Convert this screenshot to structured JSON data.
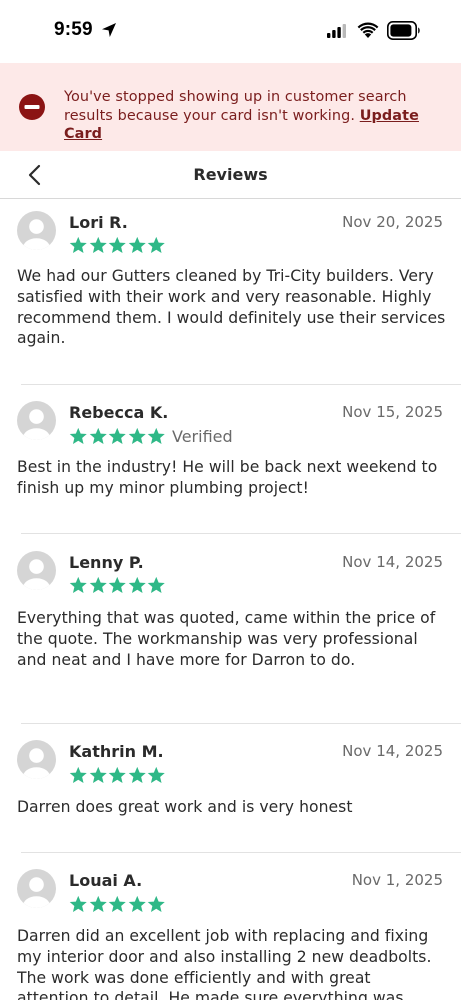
{
  "status_bar": {
    "time": "9:59",
    "location_icon": "location-arrow-icon",
    "signal_icon": "cellular-signal-icon",
    "wifi_icon": "wifi-icon",
    "battery_icon": "battery-icon"
  },
  "alert": {
    "icon": "minus-circle-icon",
    "message": "You've stopped showing up in customer search results because your card isn't working.",
    "link_label": "Update Card"
  },
  "header": {
    "back_icon": "chevron-left-icon",
    "title": "Reviews"
  },
  "colors": {
    "star": "#2fb887",
    "alert_bg": "#fde9e8",
    "alert_text": "#7a1d1d"
  },
  "reviews": [
    {
      "name": "Lori R.",
      "date": "Nov 20, 2025",
      "rating": 5,
      "verified": "",
      "text": "We had our Gutters cleaned by Tri-City builders. Very satisfied with their work and very reasonable. Highly recommend them. I would definitely use their services again."
    },
    {
      "name": "Rebecca K.",
      "date": "Nov 15, 2025",
      "rating": 5,
      "verified": "Verified",
      "text": "Best in the industry! He will be back next weekend to finish up my minor plumbing project!"
    },
    {
      "name": "Lenny P.",
      "date": "Nov 14, 2025",
      "rating": 5,
      "verified": "",
      "text": "Everything that was quoted, came within the price of the quote. The workmanship was very professional and neat and I have more for Darron to do."
    },
    {
      "name": "Kathrin M.",
      "date": "Nov 14, 2025",
      "rating": 5,
      "verified": "",
      "text": "Darren does great work and is very honest"
    },
    {
      "name": "Louai A.",
      "date": "Nov 1, 2025",
      "rating": 5,
      "verified": "",
      "text": "Darren did an excellent job with replacing and fixing my interior door and also installing 2 new deadbolts. The work was done efficiently and with great attention to detail. He made sure everything was"
    }
  ]
}
